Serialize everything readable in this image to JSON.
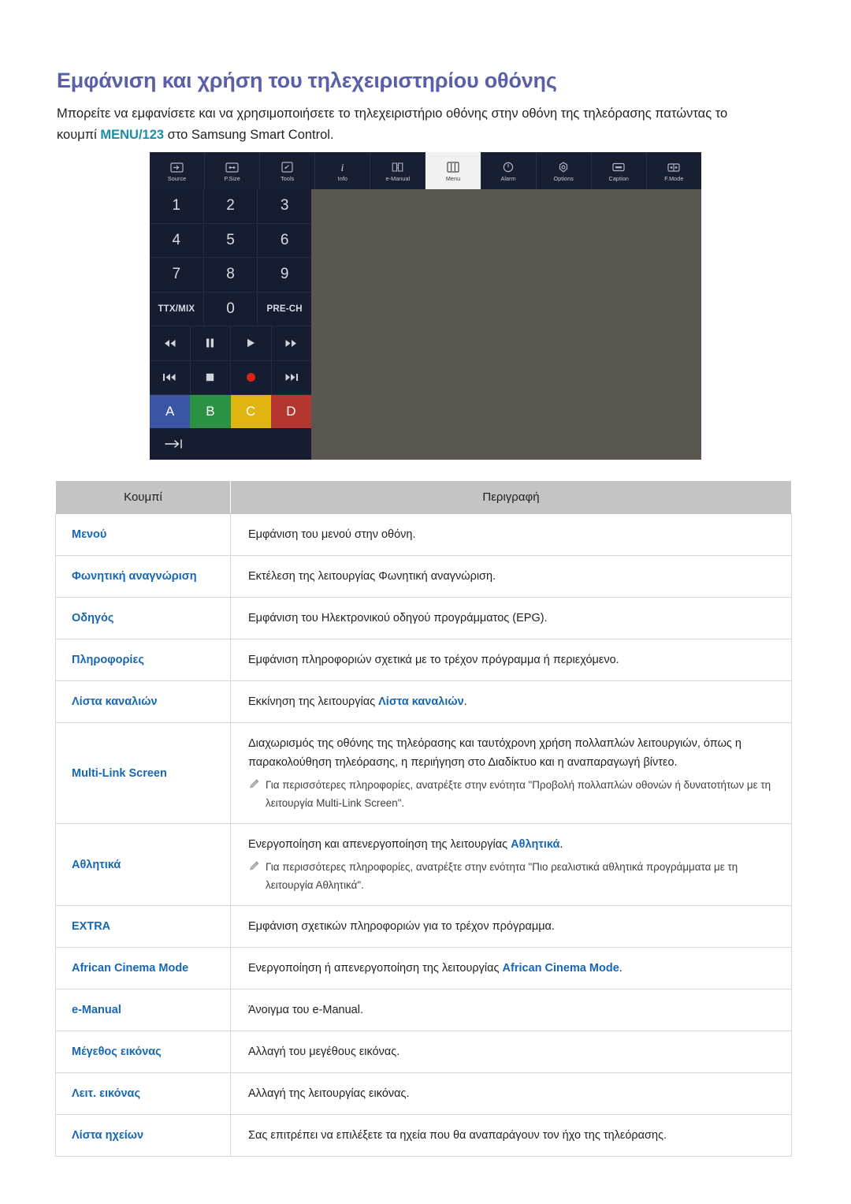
{
  "page": {
    "heading": "Εμφάνιση και χρήση του τηλεχειριστηρίου οθόνης",
    "intro_part1": "Μπορείτε να εμφανίσετε και να χρησιμοποιήσετε το τηλεχειριστήριο οθόνης στην οθόνη της τηλεόρασης πατώντας το κουμπί ",
    "intro_accent": "MENU/123",
    "intro_part2": " στο Samsung Smart Control."
  },
  "colors": {
    "heading": "#5b5fa8",
    "accent_teal": "#1b8fa6",
    "link_blue": "#1767b3",
    "remote_toolbar_bg": "#181f33",
    "remote_panel_bg": "#5a5753",
    "table_header_bg": "#c4c4c4",
    "key_blue": "#3a55a4",
    "key_green": "#2b9144",
    "key_yellow": "#e0b511",
    "key_red": "#b33630"
  },
  "remote": {
    "toolbar": [
      {
        "label": "Source",
        "icon": "source-icon",
        "active": false
      },
      {
        "label": "P.Size",
        "icon": "picture-size-icon",
        "active": false
      },
      {
        "label": "Tools",
        "icon": "tools-icon",
        "active": false
      },
      {
        "label": "Info",
        "icon": "info-icon",
        "active": false
      },
      {
        "label": "e-Manual",
        "icon": "e-manual-icon",
        "active": false
      },
      {
        "label": "Menu",
        "icon": "menu-icon",
        "active": true
      },
      {
        "label": "Alarm",
        "icon": "alarm-icon",
        "active": false
      },
      {
        "label": "Options",
        "icon": "options-icon",
        "active": false
      },
      {
        "label": "Caption",
        "icon": "caption-icon",
        "active": false
      },
      {
        "label": "F.Mode",
        "icon": "f-mode-icon",
        "active": false
      }
    ],
    "keypad": [
      [
        "1",
        "2",
        "3"
      ],
      [
        "4",
        "5",
        "6"
      ],
      [
        "7",
        "8",
        "9"
      ],
      [
        "TTX/MIX",
        "0",
        "PRE-CH"
      ]
    ],
    "media_row1": [
      "rewind",
      "pause",
      "play",
      "fast-forward"
    ],
    "media_row2": [
      "previous",
      "stop",
      "record",
      "next"
    ],
    "media_row1_glyphs": [
      "◀◀",
      "❚❚",
      "▶",
      "▶▶"
    ],
    "media_row2_glyphs": [
      "|◀◀",
      "■",
      "record-dot",
      "▶▶|"
    ],
    "color_keys": [
      {
        "label": "A",
        "color": "#3a55a4"
      },
      {
        "label": "B",
        "color": "#2b9144"
      },
      {
        "label": "C",
        "color": "#e0b511"
      },
      {
        "label": "D",
        "color": "#b33630"
      }
    ],
    "exit_glyph": "⇢|"
  },
  "table": {
    "headers": [
      "Κουμπί",
      "Περιγραφή"
    ],
    "rows": [
      {
        "button": "Μενού",
        "desc_pre": "Εμφάνιση του μενού στην οθόνη.",
        "desc_link": "",
        "desc_post": "",
        "note": ""
      },
      {
        "button": "Φωνητική αναγνώριση",
        "desc_pre": "Εκτέλεση της λειτουργίας Φωνητική αναγνώριση.",
        "desc_link": "",
        "desc_post": "",
        "note": ""
      },
      {
        "button": "Οδηγός",
        "desc_pre": "Εμφάνιση του Ηλεκτρονικού οδηγού προγράμματος (EPG).",
        "desc_link": "",
        "desc_post": "",
        "note": ""
      },
      {
        "button": "Πληροφορίες",
        "desc_pre": "Εμφάνιση πληροφοριών σχετικά με το τρέχον πρόγραμμα ή περιεχόμενο.",
        "desc_link": "",
        "desc_post": "",
        "note": ""
      },
      {
        "button": "Λίστα καναλιών",
        "desc_pre": "Εκκίνηση της λειτουργίας ",
        "desc_link": "Λίστα καναλιών",
        "desc_post": ".",
        "note": ""
      },
      {
        "button": "Multi-Link Screen",
        "desc_pre": "Διαχωρισμός της οθόνης της τηλεόρασης και ταυτόχρονη χρήση πολλαπλών λειτουργιών, όπως η παρακολούθηση τηλεόρασης, η περιήγηση στο Διαδίκτυο και η αναπαραγωγή βίντεο.",
        "desc_link": "",
        "desc_post": "",
        "note": "Για περισσότερες πληροφορίες, ανατρέξτε στην ενότητα \"Προβολή πολλαπλών οθονών ή δυνατοτήτων με τη λειτουργία Multi-Link Screen\"."
      },
      {
        "button": "Αθλητικά",
        "desc_pre": "Ενεργοποίηση και απενεργοποίηση της λειτουργίας ",
        "desc_link": "Αθλητικά",
        "desc_post": ".",
        "note": "Για περισσότερες πληροφορίες, ανατρέξτε στην ενότητα \"Πιο ρεαλιστικά αθλητικά προγράμματα με τη λειτουργία Αθλητικά\"."
      },
      {
        "button": "EXTRA",
        "desc_pre": "Εμφάνιση σχετικών πληροφοριών για το τρέχον πρόγραμμα.",
        "desc_link": "",
        "desc_post": "",
        "note": ""
      },
      {
        "button": "African Cinema Mode",
        "desc_pre": "Ενεργοποίηση ή απενεργοποίηση της λειτουργίας ",
        "desc_link": "African Cinema Mode",
        "desc_post": ".",
        "note": ""
      },
      {
        "button": "e-Manual",
        "desc_pre": "Άνοιγμα του e-Manual.",
        "desc_link": "",
        "desc_post": "",
        "note": ""
      },
      {
        "button": "Μέγεθος εικόνας",
        "desc_pre": "Αλλαγή του μεγέθους εικόνας.",
        "desc_link": "",
        "desc_post": "",
        "note": ""
      },
      {
        "button": "Λειτ. εικόνας",
        "desc_pre": "Αλλαγή της λειτουργίας εικόνας.",
        "desc_link": "",
        "desc_post": "",
        "note": ""
      },
      {
        "button": "Λίστα ηχείων",
        "desc_pre": "Σας επιτρέπει να επιλέξετε τα ηχεία που θα αναπαράγουν τον ήχο της τηλεόρασης.",
        "desc_link": "",
        "desc_post": "",
        "note": ""
      }
    ]
  }
}
